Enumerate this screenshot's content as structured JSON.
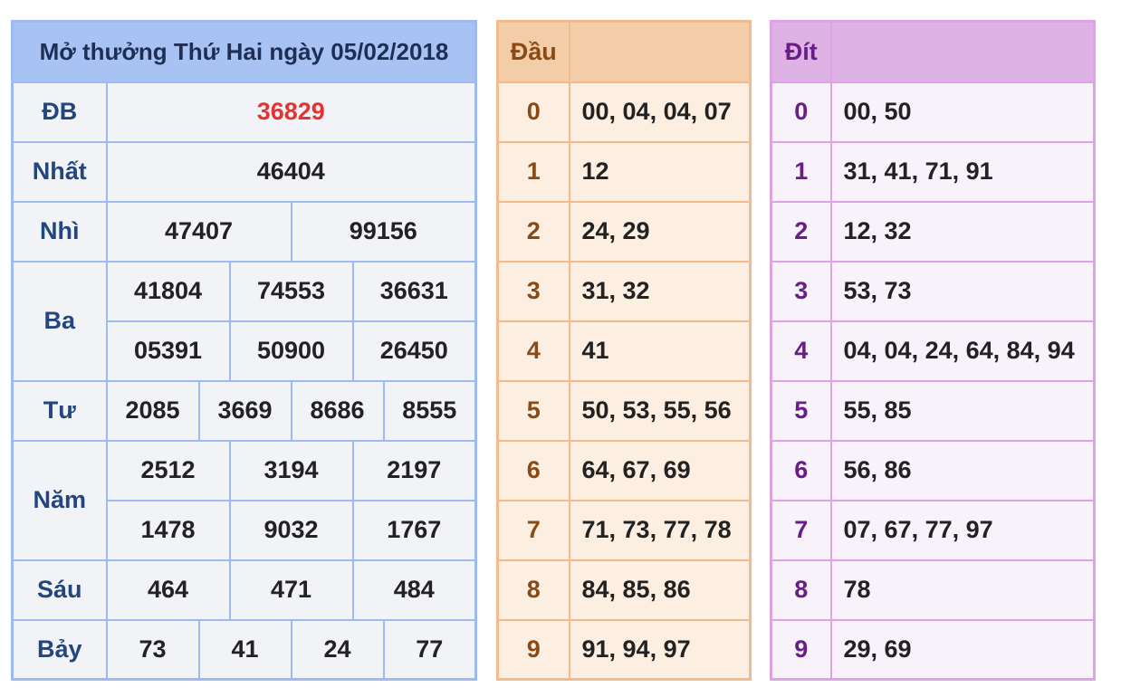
{
  "results": {
    "title": "Mở thưởng Thứ Hai ngày 05/02/2018",
    "db": {
      "label": "ĐB",
      "value": "36829"
    },
    "nhat": {
      "label": "Nhất",
      "value": "46404"
    },
    "nhi": {
      "label": "Nhì",
      "values": [
        "47407",
        "99156"
      ]
    },
    "ba": {
      "label": "Ba",
      "values": [
        "41804",
        "74553",
        "36631",
        "05391",
        "50900",
        "26450"
      ]
    },
    "tu": {
      "label": "Tư",
      "values": [
        "2085",
        "3669",
        "8686",
        "8555"
      ]
    },
    "nam": {
      "label": "Năm",
      "values": [
        "2512",
        "3194",
        "2197",
        "1478",
        "9032",
        "1767"
      ]
    },
    "sau": {
      "label": "Sáu",
      "values": [
        "464",
        "471",
        "484"
      ]
    },
    "bay": {
      "label": "Bảy",
      "values": [
        "73",
        "41",
        "24",
        "77"
      ]
    }
  },
  "dau": {
    "header": "Đầu",
    "rows": [
      {
        "key": "0",
        "values": "00, 04, 04, 07"
      },
      {
        "key": "1",
        "values": "12"
      },
      {
        "key": "2",
        "values": "24, 29"
      },
      {
        "key": "3",
        "values": "31, 32"
      },
      {
        "key": "4",
        "values": "41"
      },
      {
        "key": "5",
        "values": "50, 53, 55, 56"
      },
      {
        "key": "6",
        "values": "64, 67, 69"
      },
      {
        "key": "7",
        "values": "71, 73, 77, 78"
      },
      {
        "key": "8",
        "values": "84, 85, 86"
      },
      {
        "key": "9",
        "values": "91, 94, 97"
      }
    ]
  },
  "dit": {
    "header": "Đít",
    "rows": [
      {
        "key": "0",
        "values": "00, 50"
      },
      {
        "key": "1",
        "values": "31, 41, 71, 91"
      },
      {
        "key": "2",
        "values": "12, 32"
      },
      {
        "key": "3",
        "values": "53, 73"
      },
      {
        "key": "4",
        "values": "04, 04, 24, 64, 84, 94"
      },
      {
        "key": "5",
        "values": "55, 85"
      },
      {
        "key": "6",
        "values": "56, 86"
      },
      {
        "key": "7",
        "values": "07, 67, 77, 97"
      },
      {
        "key": "8",
        "values": "78"
      },
      {
        "key": "9",
        "values": "29, 69"
      }
    ]
  },
  "colors": {
    "results_border": "#9dbaf3",
    "results_header": "#a8c3f3",
    "special_prize": "#e53232",
    "dau_border": "#f1bb8d",
    "dau_header": "#f3cda7",
    "dit_border": "#dea3e5",
    "dit_header": "#dfb2e6"
  }
}
